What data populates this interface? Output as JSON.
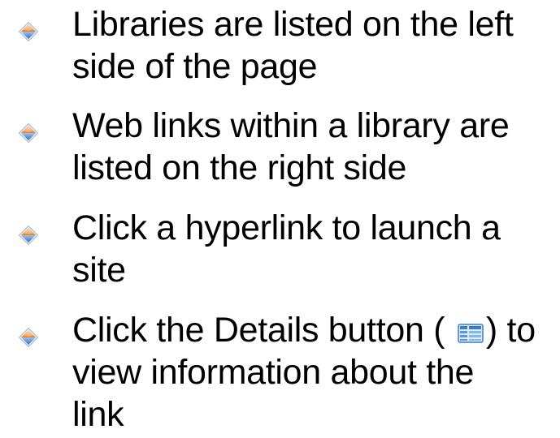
{
  "bullets": {
    "item1": {
      "line1": "Libraries are listed on the left",
      "line2": "side of the page"
    },
    "item2": {
      "line1": "Web links within a library are",
      "line2": "listed on the right side"
    },
    "item3": {
      "line1": "Click a hyperlink to launch a",
      "line2": "site"
    },
    "item4": {
      "line1_before": "Click the Details button ( ",
      "line1_after": ") to",
      "line2": "view information about the",
      "line3": "link",
      "inline_icon": "details-view-icon"
    }
  },
  "bullet_icon": "diamond-bullet-icon",
  "colors": {
    "text": "#000000",
    "bullet_orange": "#F08C3A",
    "bullet_blue": "#4A86C8",
    "icon_blue": "#3B7CC4"
  }
}
